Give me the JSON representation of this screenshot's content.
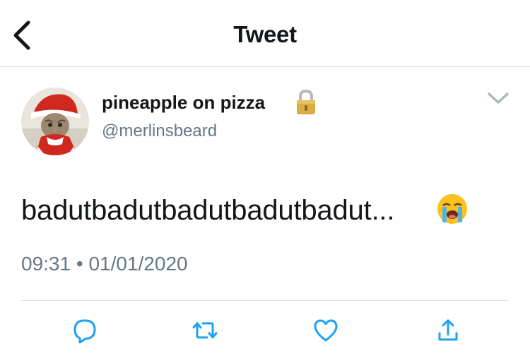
{
  "header": {
    "title": "Tweet",
    "back_icon": "chevron-left-icon"
  },
  "tweet": {
    "display_name": "pineapple on pizza",
    "protected_icon": "lock-icon",
    "handle": "@merlinsbeard",
    "menu_icon": "chevron-down-icon",
    "text": "badutbadutbadutbadutbadut...",
    "emoji": "loudly-crying-face",
    "time": "09:31",
    "separator": "•",
    "date": "01/01/2020"
  },
  "actions": [
    {
      "name": "reply",
      "icon": "reply-icon"
    },
    {
      "name": "retweet",
      "icon": "retweet-icon"
    },
    {
      "name": "like",
      "icon": "heart-icon"
    },
    {
      "name": "share",
      "icon": "share-icon"
    }
  ],
  "colors": {
    "text": "#14171a",
    "muted": "#657786",
    "icon": "#1da1f2",
    "divider": "#d8dde0"
  }
}
